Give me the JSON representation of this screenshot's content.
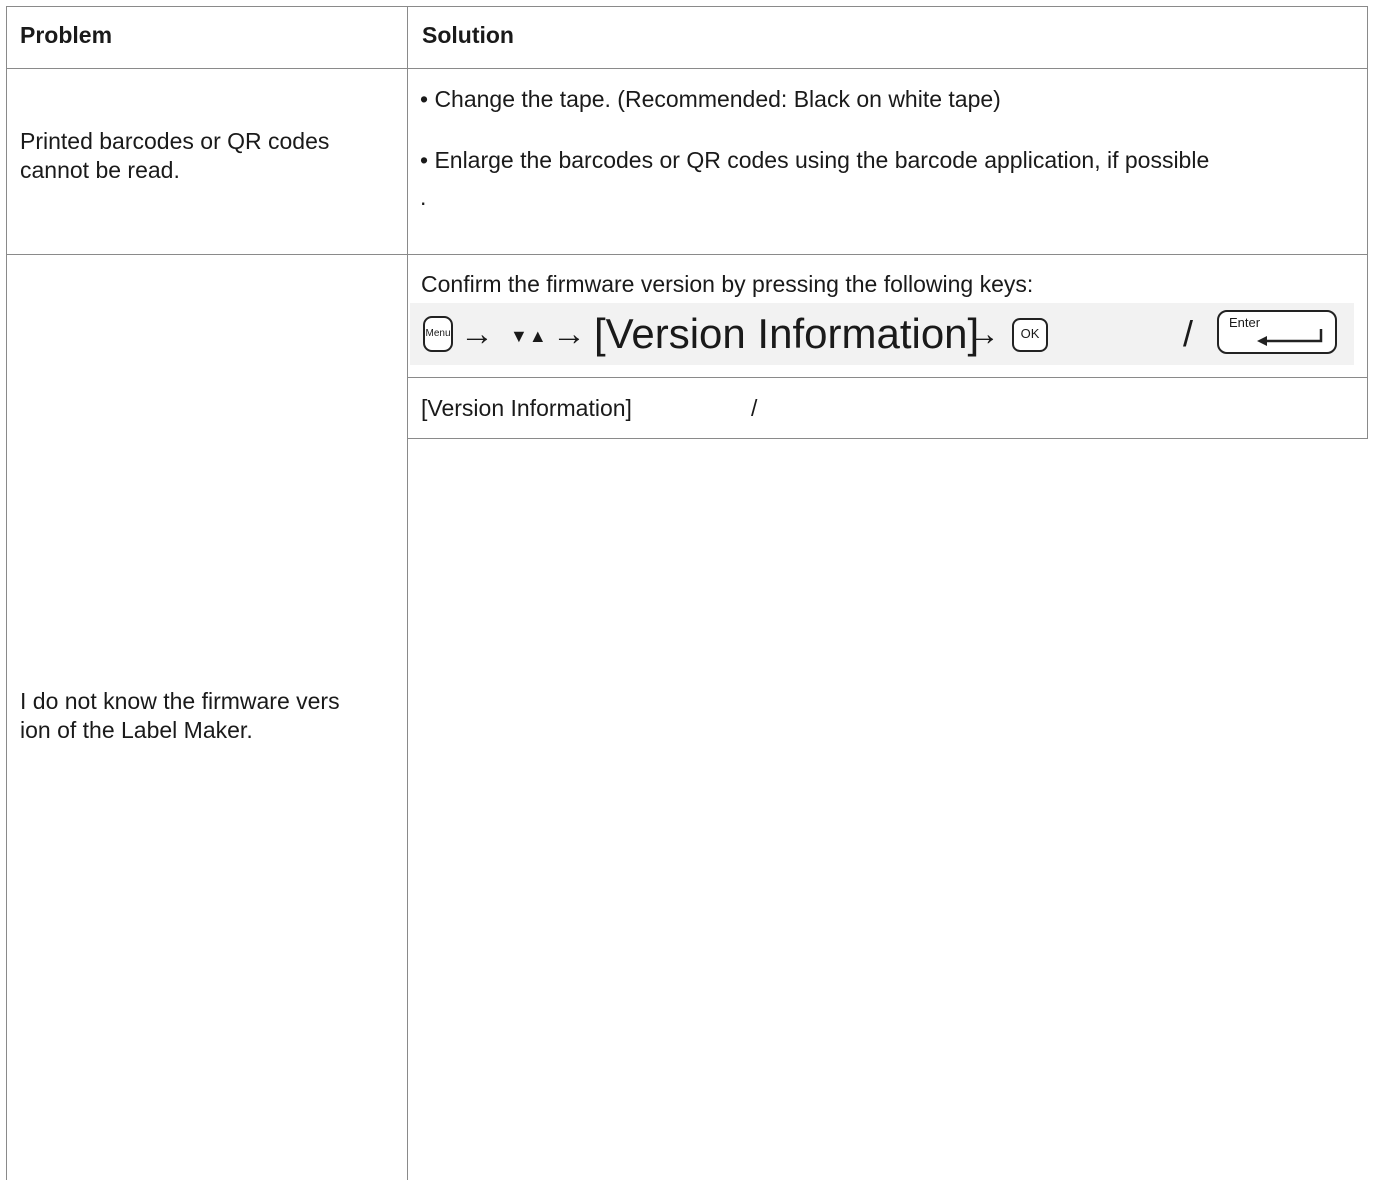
{
  "table": {
    "header": {
      "problem": "Problem",
      "solution": "Solution"
    },
    "rows": [
      {
        "problem_lines": [
          "Printed barcodes or QR codes",
          "cannot be read."
        ],
        "solution_items": [
          "• Change the tape. (Recommended: Black on white tape)",
          "• Enlarge the barcodes or QR codes using the barcode application, if possible",
          "."
        ]
      },
      {
        "problem_lines": [
          "I do not know the firmware vers",
          "ion of the Label Maker."
        ],
        "solution_intro": "Confirm the firmware version by pressing the following keys:",
        "key_sequence": {
          "menu_key": "Menu",
          "arrow_1": "→",
          "nav_keys": "▼▲",
          "arrow_2": "→",
          "target": "[Version Information]",
          "arrow_3": "→",
          "ok_key": "OK",
          "separator": "/",
          "enter_key": "Enter"
        },
        "sub_row": {
          "label": "[Version Information]",
          "separator": "/"
        }
      }
    ]
  }
}
